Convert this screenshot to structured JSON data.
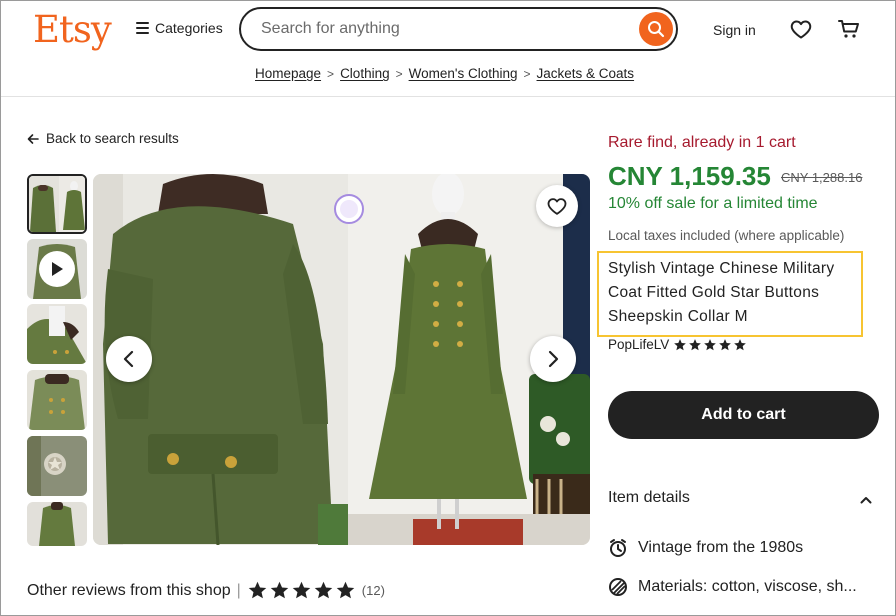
{
  "header": {
    "logo": "Etsy",
    "categories_label": "Categories",
    "search_placeholder": "Search for anything",
    "signin_label": "Sign in"
  },
  "breadcrumbs": [
    "Homepage",
    "Clothing",
    "Women's Clothing",
    "Jackets & Coats"
  ],
  "back_link": "Back to search results",
  "listing": {
    "scarcity": "Rare find, already in 1 cart",
    "price": "CNY 1,159.35",
    "original_price": "CNY 1,288.16",
    "sale_text": "10% off sale for a limited time",
    "taxes_note": "Local taxes included (where applicable)",
    "title": "Stylish Vintage Chinese Military Coat Fitted Gold Star Buttons Sheepskin Collar M",
    "shop_name": "PopLifeLV",
    "shop_rating": 5,
    "add_to_cart": "Add to cart",
    "item_details_heading": "Item details",
    "details": [
      {
        "icon": "vintage-clock-icon",
        "text": "Vintage from the 1980s"
      },
      {
        "icon": "materials-icon",
        "text": "Materials: cotton, viscose, sh..."
      }
    ]
  },
  "reviews": {
    "label": "Other reviews from this shop",
    "rating": 5,
    "count": "(12)"
  },
  "colors": {
    "brand": "#F1641E",
    "price_green": "#258635",
    "scarcity_red": "#A61A2E",
    "highlight": "#F7C431"
  }
}
